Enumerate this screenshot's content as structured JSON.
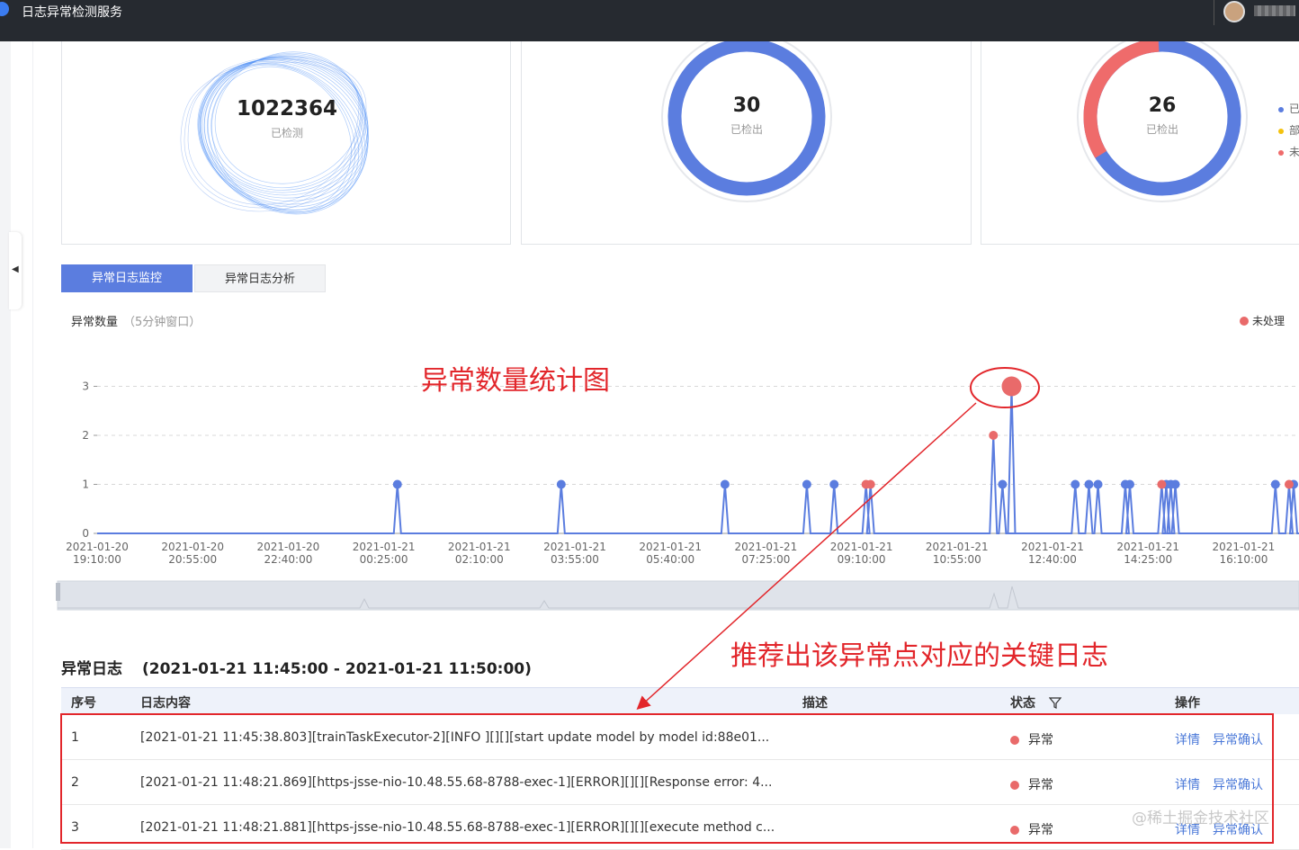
{
  "app": {
    "title": "日志异常检测服务"
  },
  "cards": [
    {
      "value": "1022364",
      "label": "已检测"
    },
    {
      "value": "30",
      "label": "已检出"
    },
    {
      "value": "26",
      "label": "已检出",
      "legend": [
        "已",
        "部",
        "未"
      ],
      "ratio_red": 0.18
    }
  ],
  "tabs": [
    "异常日志监控",
    "异常日志分析"
  ],
  "chart": {
    "title": "异常数量",
    "subtitle": "（5分钟窗口）",
    "legend": "未处理",
    "annotation": "异常数量统计图",
    "annotation2": "推荐出该异常点对应的关键日志"
  },
  "chart_data": {
    "type": "line",
    "title": "异常数量",
    "ylim": [
      0,
      3
    ],
    "yticks": [
      "0",
      "1",
      "2",
      "3"
    ],
    "xticks": [
      [
        "2021-01-20",
        "19:10:00"
      ],
      [
        "2021-01-20",
        "20:55:00"
      ],
      [
        "2021-01-20",
        "22:40:00"
      ],
      [
        "2021-01-21",
        "00:25:00"
      ],
      [
        "2021-01-21",
        "02:10:00"
      ],
      [
        "2021-01-21",
        "03:55:00"
      ],
      [
        "2021-01-21",
        "05:40:00"
      ],
      [
        "2021-01-21",
        "07:25:00"
      ],
      [
        "2021-01-21",
        "09:10:00"
      ],
      [
        "2021-01-21",
        "10:55:00"
      ],
      [
        "2021-01-21",
        "12:40:00"
      ],
      [
        "2021-01-21",
        "14:25:00"
      ],
      [
        "2021-01-21",
        "16:10:00"
      ]
    ],
    "series": [
      {
        "color": "#5b7ddf",
        "points": [
          [
            "2021-01-21 00:40",
            1
          ],
          [
            "2021-01-21 03:40",
            1
          ],
          [
            "2021-01-21 06:40",
            1
          ],
          [
            "2021-01-21 08:10",
            1
          ],
          [
            "2021-01-21 08:40",
            1
          ],
          [
            "2021-01-21 11:45",
            1
          ],
          [
            "2021-01-21 11:55",
            3
          ],
          [
            "2021-01-21 13:05",
            1
          ],
          [
            "2021-01-21 13:20",
            1
          ],
          [
            "2021-01-21 13:30",
            1
          ],
          [
            "2021-01-21 14:00",
            1
          ],
          [
            "2021-01-21 14:05",
            1
          ],
          [
            "2021-01-21 14:45",
            1
          ],
          [
            "2021-01-21 14:50",
            1
          ],
          [
            "2021-01-21 14:55",
            1
          ],
          [
            "2021-01-21 16:45",
            1
          ],
          [
            "2021-01-21 17:05",
            1
          ]
        ]
      },
      {
        "name": "未处理",
        "color": "#e96a6a",
        "points": [
          [
            "2021-01-21 09:15",
            1
          ],
          [
            "2021-01-21 09:20",
            1
          ],
          [
            "2021-01-21 11:35",
            2
          ],
          [
            "2021-01-21 11:55",
            3
          ],
          [
            "2021-01-21 14:40",
            1
          ],
          [
            "2021-01-21 17:00",
            1
          ]
        ]
      }
    ]
  },
  "log_section": {
    "title": "异常日志",
    "range": "(2021-01-21 11:45:00 - 2021-01-21 11:50:00)"
  },
  "table": {
    "headers": {
      "index": "序号",
      "content": "日志内容",
      "desc": "描述",
      "status": "状态",
      "ops": "操作"
    },
    "rows": [
      {
        "index": "1",
        "content": "[2021-01-21 11:45:38.803][trainTaskExecutor-2][INFO ][][][start update model by model id:88e01...",
        "status": "异常",
        "op1": "详情",
        "op2": "异常确认"
      },
      {
        "index": "2",
        "content": "[2021-01-21 11:48:21.869][https-jsse-nio-10.48.55.68-8788-exec-1][ERROR][][][Response error: 4...",
        "status": "异常",
        "op1": "详情",
        "op2": "异常确认"
      },
      {
        "index": "3",
        "content": "[2021-01-21 11:48:21.881][https-jsse-nio-10.48.55.68-8788-exec-1][ERROR][][][execute method c...",
        "status": "异常",
        "op1": "详情",
        "op2": "异常确认"
      }
    ]
  },
  "watermark": "@稀土掘金技术社区"
}
